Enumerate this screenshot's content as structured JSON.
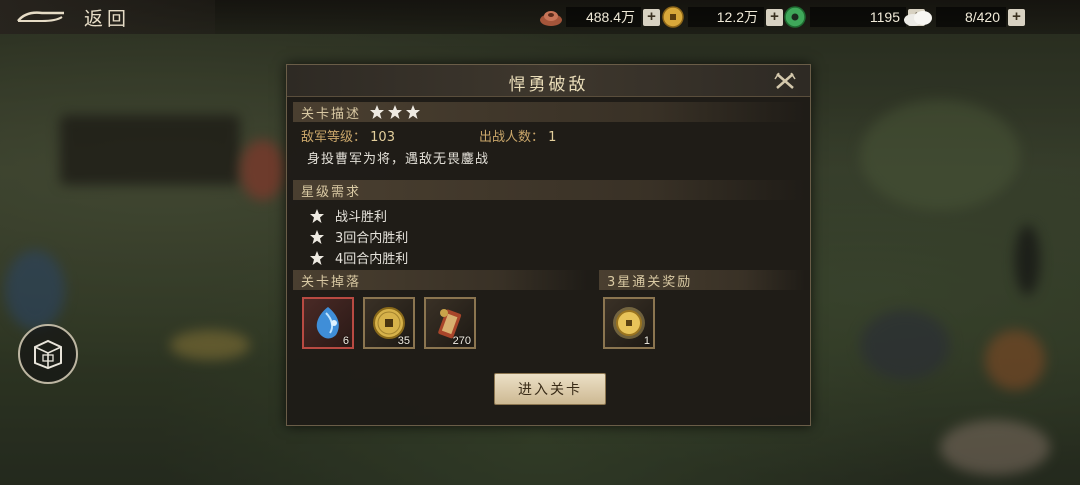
{
  "topbar": {
    "back_label": "返回",
    "resources": [
      {
        "icon": "bronze-ingot-icon",
        "value": "488.4万"
      },
      {
        "icon": "gold-coin-icon",
        "value": "12.2万"
      },
      {
        "icon": "jade-disc-icon",
        "value": "1195"
      },
      {
        "icon": "bun-food-icon",
        "value": "8/420"
      }
    ],
    "plus_label": "+"
  },
  "modal": {
    "title": "悍勇破敌",
    "description_section": {
      "label": "关卡描述",
      "stars": 3,
      "enemy_level_label": "敌军等级：",
      "enemy_level": "103",
      "troop_count_label": "出战人数：",
      "troop_count": "1",
      "description": "身投曹军为将，遇敌无畏鏖战"
    },
    "star_requirements": {
      "label": "星级需求",
      "items": [
        "战斗胜利",
        "3回合内胜利",
        "4回合内胜利"
      ]
    },
    "drops": {
      "label": "关卡掉落",
      "items": [
        {
          "icon": "blue-gem-icon",
          "qty": "6",
          "rarity": "red"
        },
        {
          "icon": "copper-coin-icon",
          "qty": "35",
          "rarity": "gold"
        },
        {
          "icon": "scroll-pouch-icon",
          "qty": "270",
          "rarity": "gold"
        }
      ]
    },
    "three_star_reward": {
      "label": "3星通关奖励",
      "items": [
        {
          "icon": "gold-coin-icon",
          "qty": "1"
        }
      ]
    },
    "enter_label": "进入关卡"
  },
  "colors": {
    "accent_gold": "#c9a66a",
    "panel_bg": "#1e1b17",
    "button_bg": "#e3d6b8",
    "rarity_red": "#b84a42"
  }
}
